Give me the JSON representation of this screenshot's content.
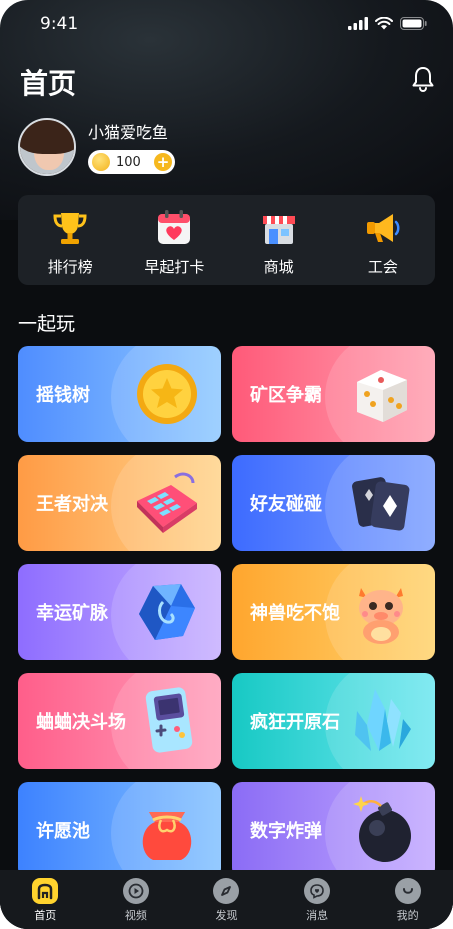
{
  "status_bar": {
    "time": "9:41"
  },
  "header": {
    "title": "首页",
    "bell_icon": "bell-icon"
  },
  "profile": {
    "username": "小猫爱吃鱼",
    "coins": "100"
  },
  "quick_actions": [
    {
      "label": "排行榜",
      "icon": "trophy-icon"
    },
    {
      "label": "早起打卡",
      "icon": "calendar-heart-icon"
    },
    {
      "label": "商城",
      "icon": "shop-icon"
    },
    {
      "label": "工会",
      "icon": "megaphone-icon"
    }
  ],
  "section": {
    "title": "一起玩"
  },
  "games": [
    {
      "label": "摇钱树",
      "icon": "gold-coin-icon",
      "color_from": "#4f8dff",
      "color_to": "#8fc9ff"
    },
    {
      "label": "矿区争霸",
      "icon": "dice-icon",
      "color_from": "#ff5a79",
      "color_to": "#ff9fb0"
    },
    {
      "label": "王者对决",
      "icon": "keyboard-icon",
      "color_from": "#ff9b45",
      "color_to": "#ffd48c"
    },
    {
      "label": "好友碰碰",
      "icon": "playing-cards-icon",
      "color_from": "#3d6bff",
      "color_to": "#7ea1ff"
    },
    {
      "label": "幸运矿脉",
      "icon": "gem-icon",
      "color_from": "#8e6dff",
      "color_to": "#c7b0ff"
    },
    {
      "label": "神兽吃不饱",
      "icon": "dragon-icon",
      "color_from": "#ffa62e",
      "color_to": "#ffd36e"
    },
    {
      "label": "蛐蛐决斗场",
      "icon": "gameboy-icon",
      "color_from": "#ff5e8a",
      "color_to": "#ff9fbb"
    },
    {
      "label": "疯狂开原石",
      "icon": "crystal-icon",
      "color_from": "#17c9c4",
      "color_to": "#6ee7f0"
    },
    {
      "label": "许愿池",
      "icon": "lucky-bag-icon",
      "color_from": "#3d82ff",
      "color_to": "#84c2ff"
    },
    {
      "label": "数字炸弹",
      "icon": "bomb-icon",
      "color_from": "#8b6cf5",
      "color_to": "#c2a8ff"
    }
  ],
  "tabs": [
    {
      "label": "首页",
      "icon": "home-icon",
      "active": true
    },
    {
      "label": "视频",
      "icon": "play-icon",
      "active": false
    },
    {
      "label": "发现",
      "icon": "compass-icon",
      "active": false
    },
    {
      "label": "消息",
      "icon": "message-icon",
      "active": false
    },
    {
      "label": "我的",
      "icon": "profile-icon",
      "active": false
    }
  ]
}
